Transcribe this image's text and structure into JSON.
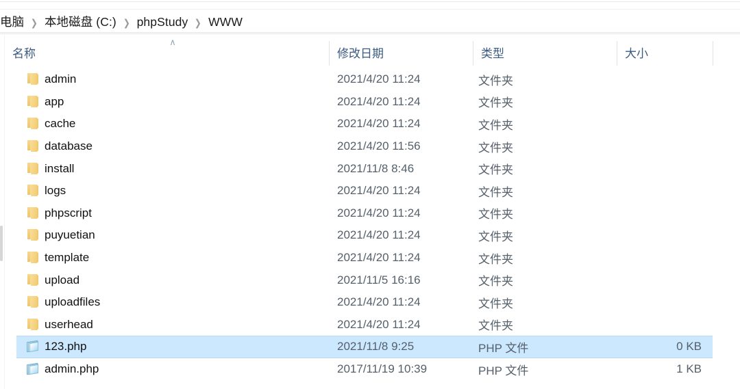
{
  "window": {
    "title": "WWW"
  },
  "breadcrumb": {
    "separator": "❯",
    "items": [
      {
        "label": "电脑"
      },
      {
        "label": "本地磁盘 (C:)"
      },
      {
        "label": "phpStudy"
      },
      {
        "label": "WWW"
      }
    ]
  },
  "columns": {
    "sort_indicator": "∧",
    "items": [
      {
        "key": "name",
        "label": "名称"
      },
      {
        "key": "date",
        "label": "修改日期"
      },
      {
        "key": "type",
        "label": "类型"
      },
      {
        "key": "size",
        "label": "大小"
      }
    ]
  },
  "colors": {
    "selection_fill": "#cce8ff",
    "selection_border": "#b6dcf5",
    "header_text": "#3b5a80",
    "secondary_text": "#55606b",
    "folder_icon": "#f1cb72",
    "php_icon": "#a8d8f0"
  },
  "files": [
    {
      "name": "admin",
      "date": "2021/4/20 11:24",
      "type": "文件夹",
      "size": "",
      "icon": "folder-icon",
      "selected": false
    },
    {
      "name": "app",
      "date": "2021/4/20 11:24",
      "type": "文件夹",
      "size": "",
      "icon": "folder-icon",
      "selected": false
    },
    {
      "name": "cache",
      "date": "2021/4/20 11:24",
      "type": "文件夹",
      "size": "",
      "icon": "folder-icon",
      "selected": false
    },
    {
      "name": "database",
      "date": "2021/4/20 11:56",
      "type": "文件夹",
      "size": "",
      "icon": "folder-icon",
      "selected": false
    },
    {
      "name": "install",
      "date": "2021/11/8 8:46",
      "type": "文件夹",
      "size": "",
      "icon": "folder-icon",
      "selected": false
    },
    {
      "name": "logs",
      "date": "2021/4/20 11:24",
      "type": "文件夹",
      "size": "",
      "icon": "folder-icon",
      "selected": false
    },
    {
      "name": "phpscript",
      "date": "2021/4/20 11:24",
      "type": "文件夹",
      "size": "",
      "icon": "folder-icon",
      "selected": false
    },
    {
      "name": "puyuetian",
      "date": "2021/4/20 11:24",
      "type": "文件夹",
      "size": "",
      "icon": "folder-icon",
      "selected": false
    },
    {
      "name": "template",
      "date": "2021/4/20 11:24",
      "type": "文件夹",
      "size": "",
      "icon": "folder-icon",
      "selected": false
    },
    {
      "name": "upload",
      "date": "2021/11/5 16:16",
      "type": "文件夹",
      "size": "",
      "icon": "folder-icon",
      "selected": false
    },
    {
      "name": "uploadfiles",
      "date": "2021/4/20 11:24",
      "type": "文件夹",
      "size": "",
      "icon": "folder-icon",
      "selected": false
    },
    {
      "name": "userhead",
      "date": "2021/4/20 11:24",
      "type": "文件夹",
      "size": "",
      "icon": "folder-icon",
      "selected": false
    },
    {
      "name": "123.php",
      "date": "2021/11/8 9:25",
      "type": "PHP 文件",
      "size": "0 KB",
      "icon": "php-file-icon",
      "selected": true
    },
    {
      "name": "admin.php",
      "date": "2017/11/19 10:39",
      "type": "PHP 文件",
      "size": "1 KB",
      "icon": "php-file-icon",
      "selected": false
    }
  ]
}
